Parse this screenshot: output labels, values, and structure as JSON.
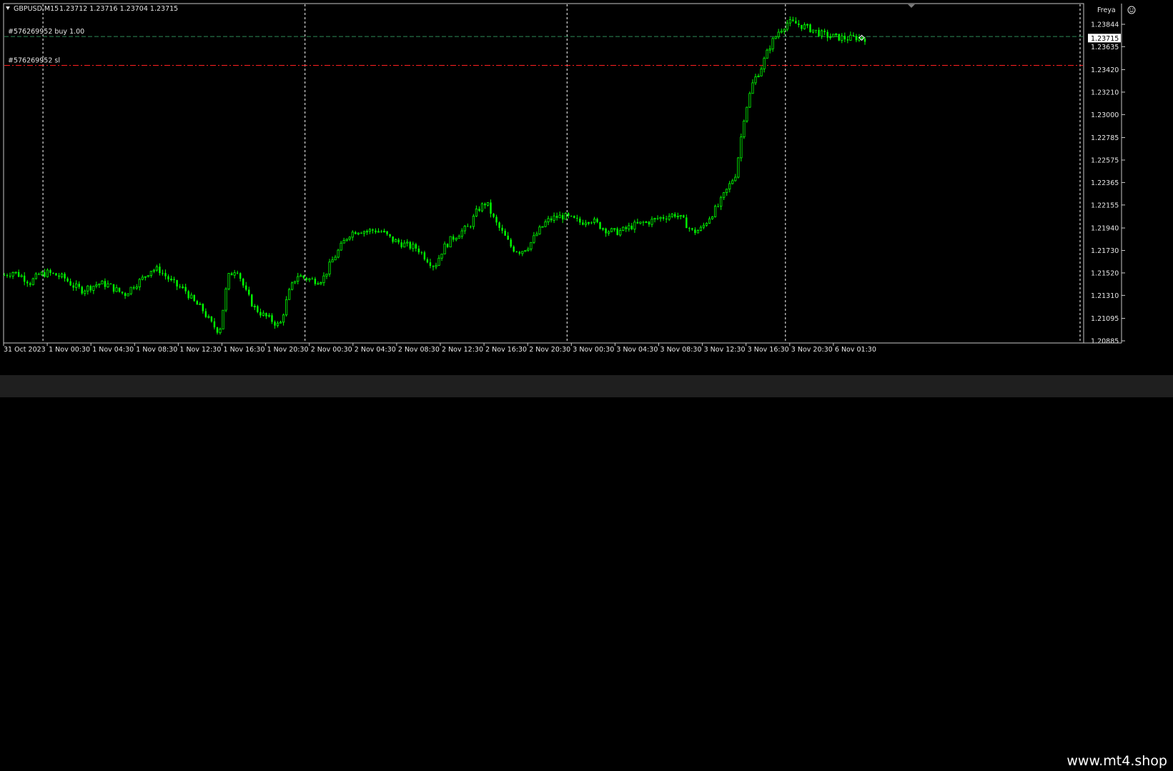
{
  "header": {
    "symbol": "GBPUSD,M15",
    "ohlc": "1.23712 1.23716 1.23704 1.23715",
    "account_name": "Freya",
    "account_icon": "smiley-face-icon"
  },
  "orders": [
    {
      "label": "#576269952 buy 1.00",
      "price": 1.2373,
      "style": "entry",
      "color": "#2e8b57"
    },
    {
      "label": "#576269952 sl",
      "price": 1.2346,
      "style": "stop-loss",
      "color": "#ff2020"
    }
  ],
  "current_price_label": "1.23715",
  "price_axis": {
    "ticks": [
      "1.23844",
      "1.23635",
      "1.23420",
      "1.23210",
      "1.23000",
      "1.22785",
      "1.22575",
      "1.22365",
      "1.22155",
      "1.21940",
      "1.21730",
      "1.21520",
      "1.21310",
      "1.21095",
      "1.20885"
    ],
    "values": [
      1.23844,
      1.23635,
      1.2342,
      1.2321,
      1.23,
      1.22785,
      1.22575,
      1.22365,
      1.22155,
      1.2194,
      1.2173,
      1.2152,
      1.2131,
      1.21095,
      1.20885
    ]
  },
  "time_axis": {
    "labels": [
      "31 Oct 2023",
      "1 Nov 00:30",
      "1 Nov 04:30",
      "1 Nov 08:30",
      "1 Nov 12:30",
      "1 Nov 16:30",
      "1 Nov 20:30",
      "2 Nov 00:30",
      "2 Nov 04:30",
      "2 Nov 08:30",
      "2 Nov 12:30",
      "2 Nov 16:30",
      "2 Nov 20:30",
      "3 Nov 00:30",
      "3 Nov 04:30",
      "3 Nov 08:30",
      "3 Nov 12:30",
      "3 Nov 16:30",
      "3 Nov 20:30",
      "6 Nov 01:30"
    ]
  },
  "day_separators": [
    "1 Nov 00:30",
    "2 Nov 00:30",
    "3 Nov 00:30",
    "3 Nov 20:30"
  ],
  "colors": {
    "background": "#000000",
    "candle": "#00ff00",
    "axis_text": "#e6e6e6",
    "separator": "#ffffff",
    "footer": "#1f1f1f"
  },
  "chart_data": {
    "type": "line",
    "series": [
      {
        "values": [
          1.215,
          1.2153,
          1.2149,
          1.2143,
          1.215,
          1.2152,
          1.215,
          1.2147,
          1.214,
          1.2136,
          1.2139,
          1.2142,
          1.2141,
          1.2136,
          1.2132,
          1.214,
          1.2146,
          1.2155,
          1.2155,
          1.2147,
          1.214,
          1.2136,
          1.2125,
          1.2118,
          1.2105,
          1.2097,
          1.2148,
          1.2157,
          1.2135,
          1.212,
          1.2113,
          1.2108,
          1.2102,
          1.2132,
          1.215,
          1.2147,
          1.2145,
          1.2146,
          1.2162,
          1.2175,
          1.2188,
          1.2192,
          1.2191,
          1.2192,
          1.219,
          1.2183,
          1.218,
          1.2177,
          1.2175,
          1.2166,
          1.2158,
          1.2175,
          1.2184,
          1.219,
          1.2195,
          1.2211,
          1.2218,
          1.22,
          1.2188,
          1.2175,
          1.2172,
          1.2178,
          1.219,
          1.22,
          1.2204,
          1.2205,
          1.2202,
          1.2199,
          1.2203,
          1.2197,
          1.2192,
          1.219,
          1.2192,
          1.2196,
          1.2198,
          1.22,
          1.2203,
          1.2205,
          1.2207,
          1.22,
          1.219,
          1.2193,
          1.2205,
          1.2215,
          1.223,
          1.2245,
          1.23,
          1.233,
          1.2345,
          1.2365,
          1.2378,
          1.2386,
          1.2385,
          1.2382,
          1.2379,
          1.2375,
          1.2373,
          1.2372,
          1.2371,
          1.2372,
          1.23715
        ]
      }
    ],
    "ylim": [
      1.2085,
      1.2395
    ]
  }
}
